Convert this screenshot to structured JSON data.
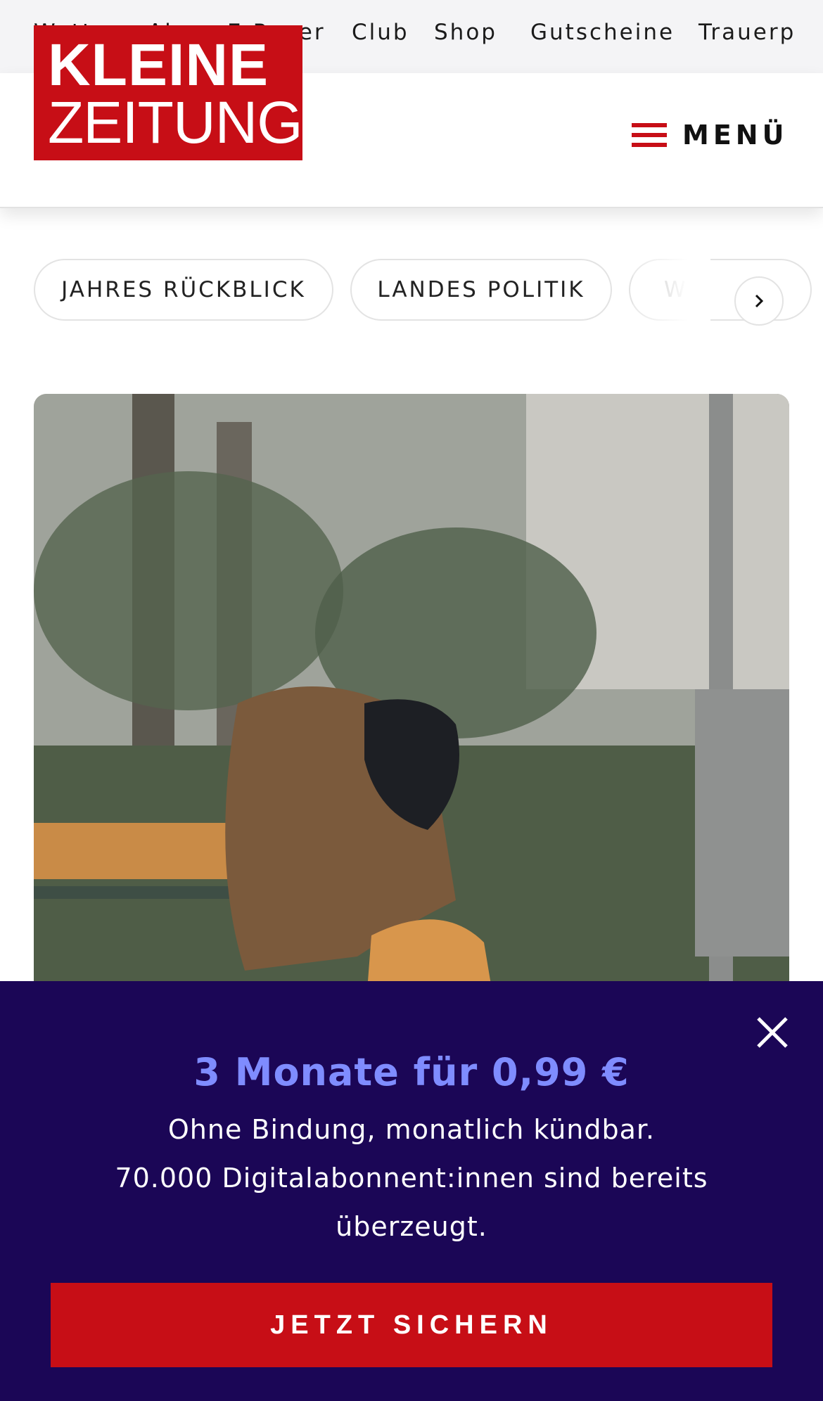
{
  "top_nav": [
    "Wetter",
    "Abo",
    "E-Paper",
    "Club",
    "Shop",
    "Gutscheine",
    "Trauerp"
  ],
  "logo": {
    "line1": "KLEINE",
    "line2": "ZEITUNG"
  },
  "menu": {
    "label": "MENÜ",
    "icon": "hamburger-icon"
  },
  "chips": [
    "JAHRES RÜCKBLICK",
    "LANDES POLITIK",
    "WE"
  ],
  "chips_next_icon": "chevron-right-icon",
  "hero": {
    "icon": "photo-person-on-bench"
  },
  "paywall": {
    "offer": "3 Monate für 0,99 €",
    "line1": "Ohne Bindung, monatlich kündbar.",
    "line2": "70.000 Digitalabonnent:innen sind bereits",
    "line3": "überzeugt.",
    "cta": "JETZT SICHERN",
    "close_icon": "close-icon"
  },
  "colors": {
    "brand_red": "#c70e16",
    "paywall_bg": "#1b0656",
    "offer_blue": "#7f8cff"
  }
}
